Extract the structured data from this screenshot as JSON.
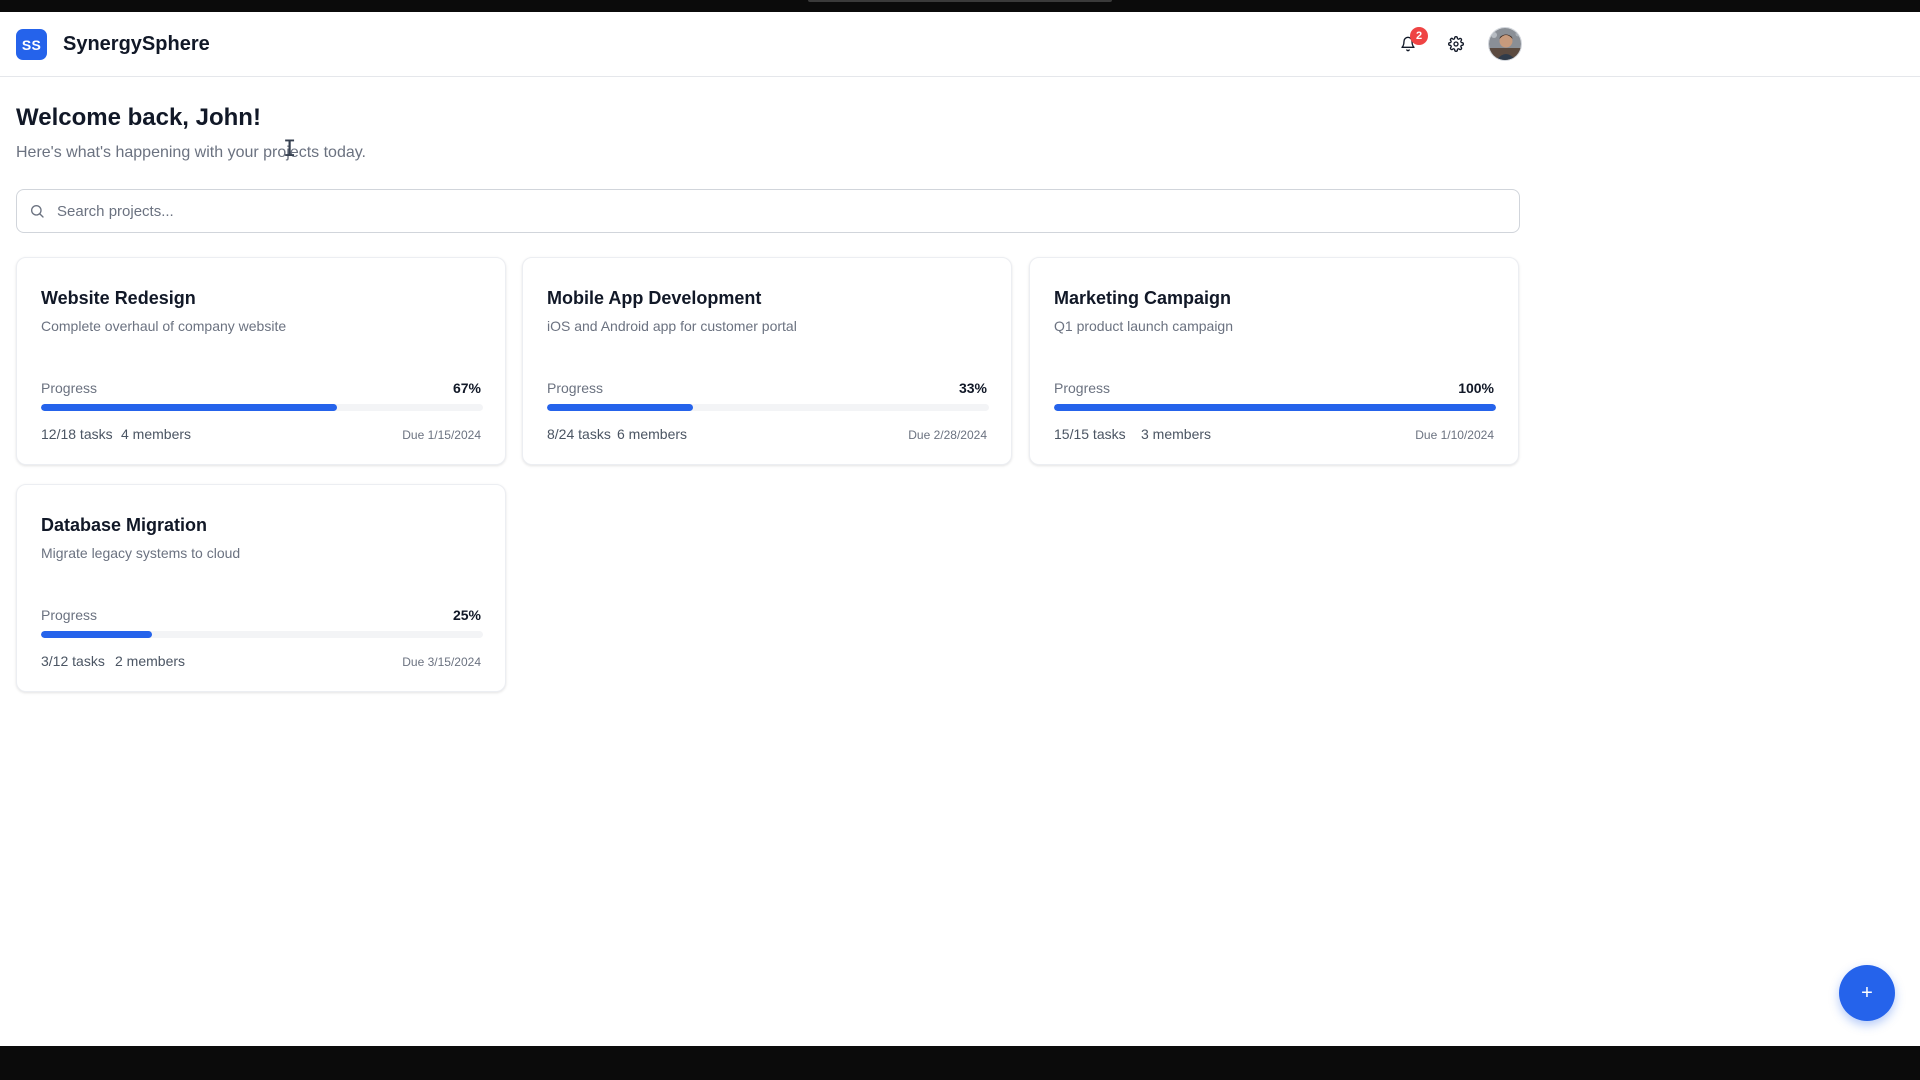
{
  "app": {
    "logo_text": "SS",
    "name": "SynergySphere"
  },
  "header": {
    "notification_count": "2",
    "icons": [
      "bell-icon",
      "gear-icon",
      "user-avatar"
    ]
  },
  "welcome": {
    "title": "Welcome back, John!",
    "subtitle": "Here's what's happening with your projects today."
  },
  "search": {
    "placeholder": "Search projects...",
    "value": ""
  },
  "projects": [
    {
      "title": "Website Redesign",
      "description": "Complete overhaul of company website",
      "progress_label": "Progress",
      "progress_text": "67%",
      "progress": 0.67,
      "tasks": "12/18 tasks",
      "members": "4 members",
      "due": "Due 1/15/2024"
    },
    {
      "title": "Mobile App Development",
      "description": "iOS and Android app for customer portal",
      "progress_label": "Progress",
      "progress_text": "33%",
      "progress": 0.33,
      "tasks": "8/24 tasks",
      "members": "6 members",
      "due": "Due 2/28/2024"
    },
    {
      "title": "Marketing Campaign",
      "description": "Q1 product launch campaign",
      "progress_label": "Progress",
      "progress_text": "100%",
      "progress": 1.0,
      "tasks": "15/15 tasks",
      "members": "3 members",
      "due": "Due 1/10/2024"
    },
    {
      "title": "Database Migration",
      "description": "Migrate legacy systems to cloud",
      "progress_label": "Progress",
      "progress_text": "25%",
      "progress": 0.25,
      "tasks": "3/12 tasks",
      "members": "2 members",
      "due": "Due 3/15/2024"
    }
  ],
  "fab": {
    "label": "+"
  },
  "colors": {
    "accent": "#2563eb",
    "badge": "#ef4444"
  }
}
